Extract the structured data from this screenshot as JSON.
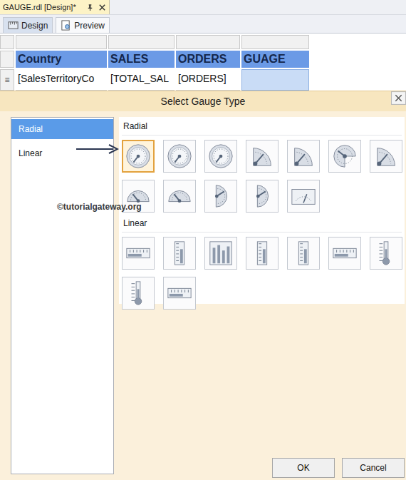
{
  "document_tab": {
    "title": "GAUGE.rdl [Design]*"
  },
  "view_tabs": [
    {
      "label": "Design",
      "selected": true
    },
    {
      "label": "Preview",
      "selected": false
    }
  ],
  "table": {
    "columns": [
      "Country",
      "SALES",
      "ORDERS",
      "GUAGE"
    ],
    "rows": [
      {
        "handle": "≡",
        "cells": [
          {
            "text": "[SalesTerritoryCo",
            "selected": false
          },
          {
            "text": "[TOTAL_SAL",
            "selected": false
          },
          {
            "text": "[ORDERS]",
            "selected": false
          },
          {
            "text": "",
            "selected": true
          }
        ]
      }
    ]
  },
  "dialog": {
    "title": "Select Gauge Type",
    "categories": [
      {
        "label": "Radial",
        "selected": true
      },
      {
        "label": "Linear",
        "selected": false
      }
    ],
    "groups": [
      {
        "label": "Radial",
        "gauges": [
          {
            "kind": "radial",
            "selected": true
          },
          {
            "kind": "radial",
            "selected": false
          },
          {
            "kind": "radial",
            "selected": false
          },
          {
            "kind": "quarter",
            "selected": false
          },
          {
            "kind": "quarter",
            "selected": false
          },
          {
            "kind": "three-quarter",
            "selected": false
          },
          {
            "kind": "quarter",
            "selected": false
          },
          {
            "kind": "half",
            "selected": false
          },
          {
            "kind": "half",
            "selected": false
          },
          {
            "kind": "half-vertical",
            "selected": false
          },
          {
            "kind": "half-vertical",
            "selected": false
          },
          {
            "kind": "meter",
            "selected": false
          }
        ]
      },
      {
        "label": "Linear",
        "gauges": [
          {
            "kind": "horizontal",
            "selected": false
          },
          {
            "kind": "vertical",
            "selected": false
          },
          {
            "kind": "multi-bar",
            "selected": false
          },
          {
            "kind": "vertical",
            "selected": false
          },
          {
            "kind": "vertical",
            "selected": false
          },
          {
            "kind": "horizontal",
            "selected": false
          },
          {
            "kind": "thermometer",
            "selected": false
          },
          {
            "kind": "thermometer",
            "selected": false
          },
          {
            "kind": "horizontal",
            "selected": false
          }
        ]
      }
    ],
    "watermark": "©tutorialgateway.org",
    "buttons": [
      "OK",
      "Cancel"
    ]
  }
}
